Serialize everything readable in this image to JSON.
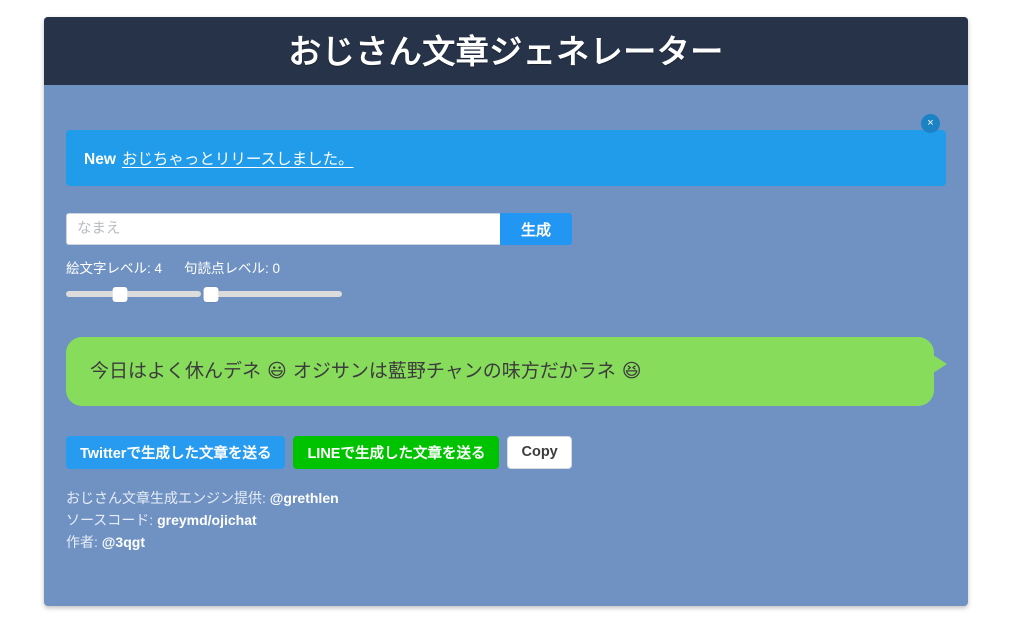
{
  "header": {
    "title": "おじさん文章ジェネレーター"
  },
  "alert": {
    "badge": "New",
    "link_text": "おじちゃっとリリースしました。",
    "close_icon": "close-icon",
    "close_label": "×",
    "background_color": "#209ceb"
  },
  "form": {
    "name_placeholder": "なまえ",
    "name_value": "",
    "generate_label": "生成"
  },
  "sliders": [
    {
      "label": "絵文字レベル: 4",
      "name": "emoji-level",
      "value": 4,
      "min": 0,
      "max": 10,
      "percent": 40
    },
    {
      "label": "句読点レベル: 0",
      "name": "punctuation-level",
      "value": 0,
      "min": 0,
      "max": 10,
      "percent": 3
    }
  ],
  "result": {
    "message": "今日はよく休んデネ 😃 オジサンは藍野チャンの味方だかラネ 😆",
    "bubble_color": "#87dd5b"
  },
  "share": {
    "twitter_label": "Twitterで生成した文章を送る",
    "line_label": "LINEで生成した文章を送る",
    "copy_label": "Copy",
    "twitter_color": "#269bf0",
    "line_color": "#00c300"
  },
  "footer": {
    "engine_prefix": "おじさん文章生成エンジン提供: ",
    "engine_link": "@grethlen",
    "source_prefix": "ソースコード: ",
    "source_link": "greymd/ojichat",
    "author_prefix": "作者: ",
    "author_link": "@3qgt"
  }
}
